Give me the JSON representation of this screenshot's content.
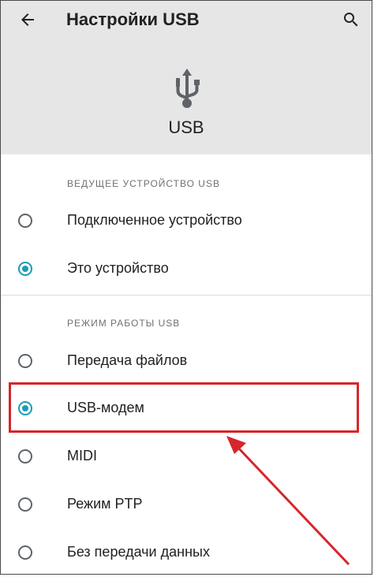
{
  "header": {
    "title": "Настройки USB",
    "usb_caption": "USB",
    "back_icon": "arrow-back-icon",
    "search_icon": "search-icon",
    "usb_icon": "usb-icon",
    "background": "#e6e6e6"
  },
  "sections": [
    {
      "title": "ВЕДУЩЕЕ УСТРОЙСТВО USB",
      "options": [
        {
          "label": "Подключенное устройство",
          "selected": false
        },
        {
          "label": "Это устройство",
          "selected": true
        }
      ]
    },
    {
      "title": "РЕЖИМ РАБОТЫ USB",
      "options": [
        {
          "label": "Передача файлов",
          "selected": false
        },
        {
          "label": "USB-модем",
          "selected": true
        },
        {
          "label": "MIDI",
          "selected": false
        },
        {
          "label": "Режим PTP",
          "selected": false
        },
        {
          "label": "Без передачи данных",
          "selected": false
        }
      ]
    }
  ],
  "colors": {
    "accent": "#1a9cb4",
    "annotation": "#d6262b"
  }
}
